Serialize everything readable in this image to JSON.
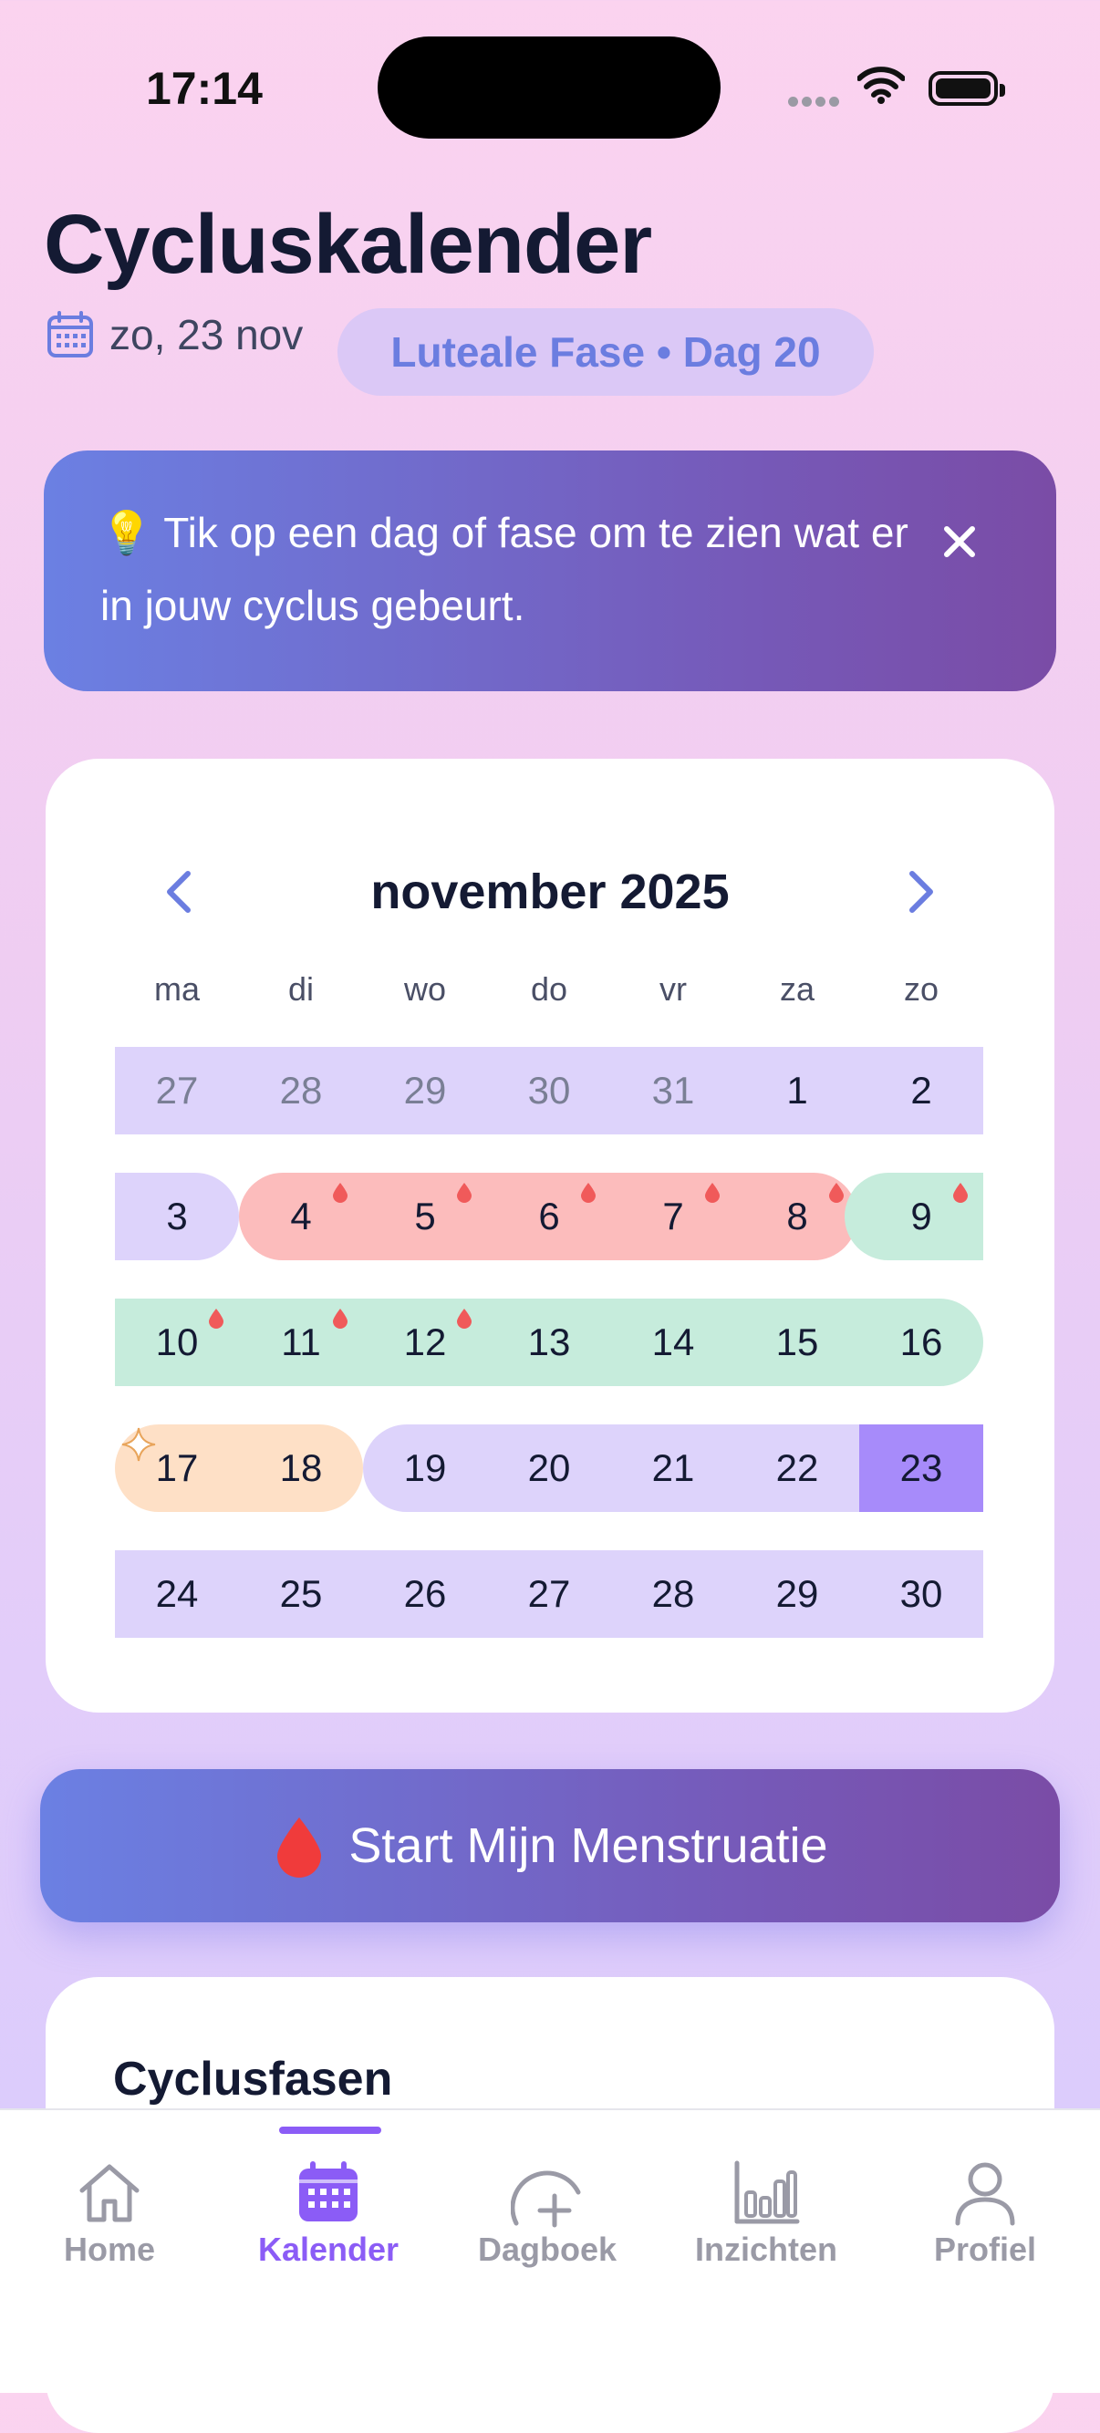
{
  "status_bar": {
    "time": "17:14"
  },
  "header": {
    "title": "Cycluskalender",
    "date": "zo, 23 nov",
    "phase_badge": "Luteale Fase • Dag 20"
  },
  "hint": {
    "emoji": "💡",
    "text": "Tik op een dag of fase om te zien wat er in jouw cyclus gebeurt."
  },
  "calendar": {
    "month_title": "november 2025",
    "weekdays": [
      "ma",
      "di",
      "wo",
      "do",
      "vr",
      "za",
      "zo"
    ],
    "weeks": [
      [
        "27",
        "28",
        "29",
        "30",
        "31",
        "1",
        "2"
      ],
      [
        "3",
        "4",
        "5",
        "6",
        "7",
        "8",
        "9"
      ],
      [
        "10",
        "11",
        "12",
        "13",
        "14",
        "15",
        "16"
      ],
      [
        "17",
        "18",
        "19",
        "20",
        "21",
        "22",
        "23"
      ],
      [
        "24",
        "25",
        "26",
        "27",
        "28",
        "29",
        "30"
      ]
    ],
    "colors": {
      "luteal": "#ddd3fb",
      "menstruation": "#fcbcbc",
      "follicular": "#c6ecdc",
      "ovulation": "#fee0c6",
      "today": "#a78bfa",
      "drop": "#f05a5a"
    }
  },
  "start_button": {
    "label": "Start Mijn Menstruatie"
  },
  "phases_card": {
    "title": "Cyclusfasen"
  },
  "tabbar": {
    "items": [
      {
        "label": "Home",
        "icon": "home-icon"
      },
      {
        "label": "Kalender",
        "icon": "calendar-icon"
      },
      {
        "label": "Dagboek",
        "icon": "journal-plus-icon"
      },
      {
        "label": "Inzichten",
        "icon": "chart-icon"
      },
      {
        "label": "Profiel",
        "icon": "profile-icon"
      }
    ],
    "active": "Kalender",
    "accent": "#8b5cf6"
  }
}
